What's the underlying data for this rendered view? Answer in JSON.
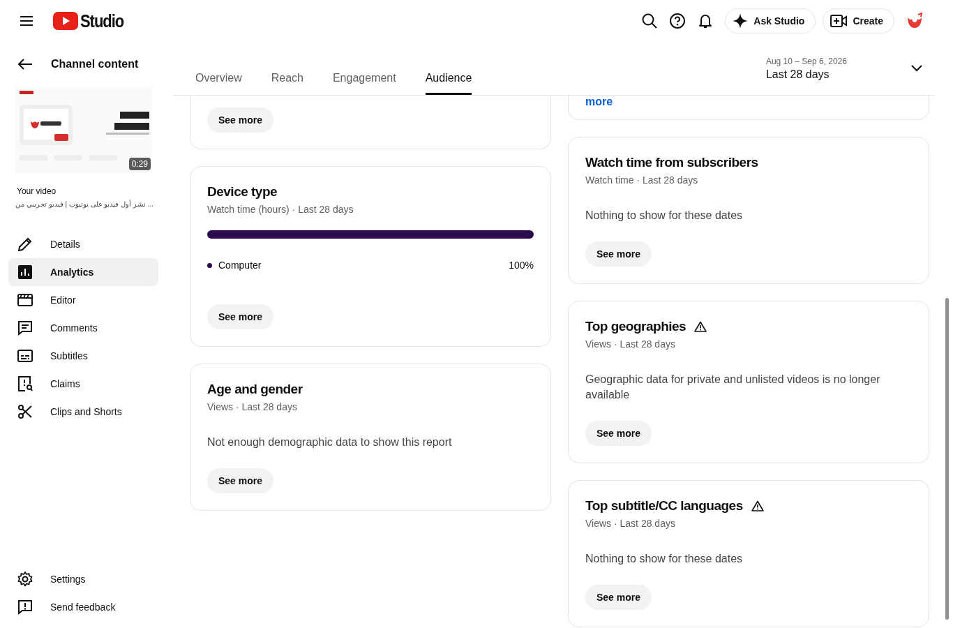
{
  "header": {
    "logo_text": "Studio",
    "ask_button": "Ask Studio",
    "create_button": "Create"
  },
  "sidebar": {
    "back_label": "Channel content",
    "thumbnail": {
      "kind": "picture",
      "duration": "0:29"
    },
    "video_label": "Your video",
    "video_title": "... نشر أول فيديو على يوتيوب | فيديو تجريبي من",
    "items": [
      {
        "label": "Details",
        "selected": false
      },
      {
        "label": "Analytics",
        "selected": true
      },
      {
        "label": "Editor",
        "selected": false
      },
      {
        "label": "Comments",
        "selected": false
      },
      {
        "label": "Subtitles",
        "selected": false
      },
      {
        "label": "Claims",
        "selected": false
      },
      {
        "label": "Clips and Shorts",
        "selected": false
      }
    ],
    "bottom_items": [
      {
        "label": "Settings"
      },
      {
        "label": "Send feedback"
      }
    ]
  },
  "tabs": [
    {
      "label": "Overview",
      "selected": false
    },
    {
      "label": "Reach",
      "selected": false
    },
    {
      "label": "Engagement",
      "selected": false
    },
    {
      "label": "Audience",
      "selected": true
    }
  ],
  "date_range": {
    "dates": "Aug 10 – Sep 6, 2026",
    "label": "Last 28 days"
  },
  "left_cards": [
    {
      "kind": "partial",
      "button": "See more"
    },
    {
      "kind": "device",
      "title": "Device type",
      "subtitle": "Watch time (hours) · Last 28 days",
      "legend": [
        {
          "label": "Computer",
          "value": "100%",
          "level": 1,
          "color": "#2b0a4d"
        }
      ],
      "button": "See more"
    },
    {
      "kind": "message",
      "title": "Age and gender",
      "subtitle": "Views · Last 28 days",
      "message": "Not enough demographic data to show this report",
      "button": "See more"
    }
  ],
  "right_cards": [
    {
      "kind": "partial_link",
      "link": "more"
    },
    {
      "kind": "message",
      "title": "Watch time from subscribers",
      "subtitle": "Watch time · Last 28 days",
      "message": "Nothing to show for these dates",
      "button": "See more",
      "warning": false
    },
    {
      "kind": "message",
      "title": "Top geographies",
      "subtitle": "Views · Last 28 days",
      "message": "Geographic data for private and unlisted videos is no longer available",
      "button": "See more",
      "warning": true
    },
    {
      "kind": "message",
      "title": "Top subtitle/CC languages",
      "subtitle": "Views · Last 28 days",
      "message": "Nothing to show for these dates",
      "button": "See more",
      "warning": true
    }
  ]
}
